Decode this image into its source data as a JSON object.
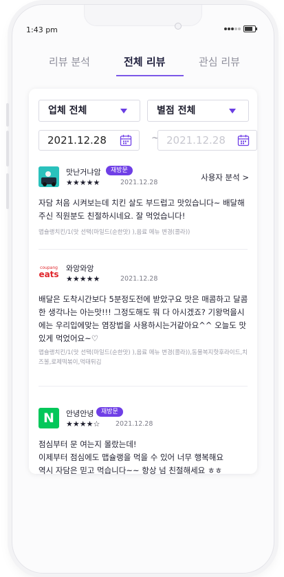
{
  "status": {
    "time": "1:43 pm"
  },
  "tabs": [
    {
      "label": "리뷰 분석"
    },
    {
      "label": "전체 리뷰"
    },
    {
      "label": "관심 리뷰"
    }
  ],
  "filters": {
    "company": "업체 전체",
    "rating": "별점 전체",
    "date_from": "2021.12.28",
    "date_to": "2021.12.28",
    "date_separator": "~"
  },
  "reviews": [
    {
      "platform_icon": "baemin-logo",
      "logo_text": "배민",
      "name": "맛난거냐암",
      "badge": "재방문",
      "stars": "★★★★★",
      "rating": 5,
      "date": "2021.12.28",
      "action": "사용자 분석 >",
      "text": "자담 처음 시켜보는데 치킨 살도 부드럽고 맛있습니다~ 배달해주신 직원분도 친절하시네요. 잘 먹었습니다!",
      "order": "맵슐랭치킨/1(맛 선택(마일드(순한맛) ),음료 메뉴 변경(콜라))"
    },
    {
      "platform_icon": "coupang-eats-logo",
      "logo_small": "coupang",
      "logo_text": "eats",
      "name": "와앙와앙",
      "badge": "",
      "stars": "★★★★★",
      "rating": 5,
      "date": "2021.12.28",
      "text": "배달은 도착시간보다 5분정도전에 받았구요 맛은 매콤하고 달콤한 생각나는 아는맛!!! 그정도해도 뭐 다 아시겠죠? 기왕먹을시에는 우리입에맞는 염장법을 사용하시는거같아요^^ 오늘도 맛있게 먹었어요~♡",
      "order": "맵슐랭치킨/1(맛 선택(마일드(순한맛) ),음료 메뉴 변경(콜라)),동물복지핫후라이드,치즈볼,로제떡볶이,먹태튀김"
    },
    {
      "platform_icon": "naver-logo",
      "logo_text": "N",
      "name": "안녕안녕",
      "badge": "재방문",
      "stars": "★★★★☆",
      "rating": 4,
      "date": "2021.12.28",
      "text": "점심부터 문 여는지 몰랐는데!\n이제부터 점심에도 맵슐랭을 먹을 수 있어 너무 행복해요\n역시 자담은 믿고 먹습니다~~ 항상 넘 친절해세요 ㅎㅎ",
      "order": ""
    }
  ],
  "colors": {
    "accent": "#6f3fe6",
    "text": "#1e1e2e",
    "muted": "#9c9ca8",
    "naver_green": "#03c75a",
    "coupang_red": "#e0252b"
  }
}
